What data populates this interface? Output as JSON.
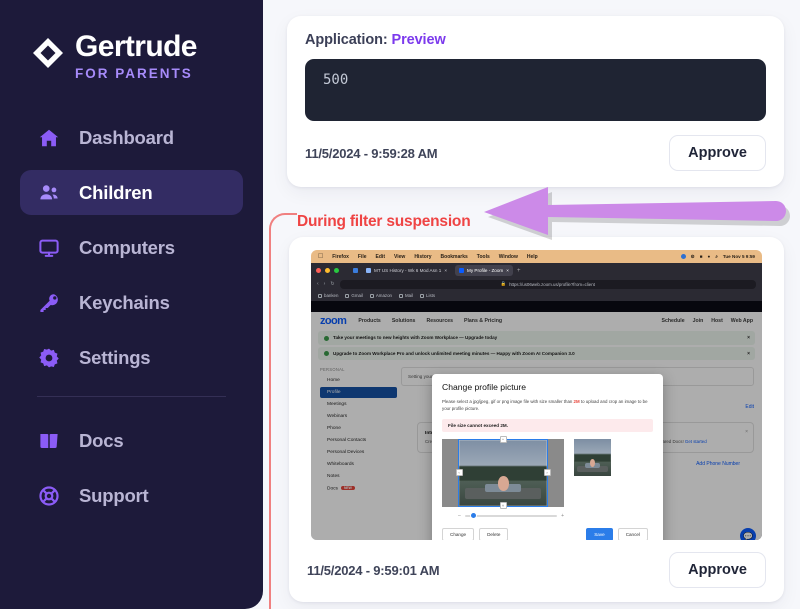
{
  "brand": {
    "name": "Gertrude",
    "subtitle": "FOR PARENTS"
  },
  "sidebar": {
    "items": [
      {
        "label": "Dashboard",
        "icon": "home-icon"
      },
      {
        "label": "Children",
        "icon": "users-icon",
        "active": true
      },
      {
        "label": "Computers",
        "icon": "monitor-icon"
      },
      {
        "label": "Keychains",
        "icon": "key-icon"
      },
      {
        "label": "Settings",
        "icon": "gear-icon"
      }
    ],
    "secondary": [
      {
        "label": "Docs",
        "icon": "book-icon"
      },
      {
        "label": "Support",
        "icon": "lifebuoy-icon"
      }
    ]
  },
  "cards": [
    {
      "app_label": "Application:",
      "app_name": "Preview",
      "code": "500",
      "timestamp": "11/5/2024 - 9:59:28 AM",
      "approve_label": "Approve"
    },
    {
      "timestamp": "11/5/2024 - 9:59:01 AM",
      "approve_label": "Approve"
    }
  ],
  "annotation": {
    "label": "During filter suspension",
    "arrow": "left-arrow-icon",
    "color": "#ef4444"
  },
  "screenshot": {
    "os_menu": [
      "Firefox",
      "File",
      "Edit",
      "View",
      "History",
      "Bookmarks",
      "Tools",
      "Window",
      "Help"
    ],
    "os_clock": "Tue Nov 5  9:59",
    "tabs": [
      {
        "title": "MT US History - Wk 6 Mod Asn 1",
        "active": false
      },
      {
        "title": "My Profile - Zoom",
        "active": true
      }
    ],
    "url": "https://us06web.zoom.us/profile?from=client",
    "bookmarks": [
      "banken",
      "Gmail",
      "Amazon",
      "Mail",
      "Lists"
    ],
    "site": {
      "logo": "zoom",
      "nav": [
        "Products",
        "Solutions",
        "Resources",
        "Plans & Pricing"
      ],
      "nav_right": [
        "Schedule",
        "Join",
        "Host",
        "Web App"
      ],
      "notices": [
        "Take your meetings to new heights with Zoom Workplace — Upgrade today",
        "Upgrade to Zoom Workplace Pro and unlock unlimited meeting minutes — Happy with Zoom AI Companion 3.0"
      ],
      "sidebar_section": "PERSONAL",
      "sidebar_items": [
        {
          "label": "Home"
        },
        {
          "label": "Profile",
          "active": true
        },
        {
          "label": "Meetings"
        },
        {
          "label": "Webinars"
        },
        {
          "label": "Phone"
        },
        {
          "label": "Personal Contacts"
        },
        {
          "label": "Personal Devices"
        },
        {
          "label": "Whiteboards"
        },
        {
          "label": "Notes"
        },
        {
          "label": "Docs",
          "badge": "NEW"
        }
      ],
      "panel_text": "Setting your name and profile picture. Only the account owner and host when you are in a meeting, webinar.",
      "panel_link": "account owner",
      "edit_link": "Edit",
      "promo": {
        "title": "Introducing Zoom Docs",
        "body": "Create, share, and co-edit on Docs directly in meetings or the Zoom app for real-time updates. Try it today with two free shared Docs!",
        "link": "Get started"
      },
      "add_phone": "Add Phone Number"
    },
    "modal": {
      "title": "Change profile picture",
      "body_before": "Please select a jpg/jpeg, gif or png image file with size smaller than ",
      "body_highlight": "2M",
      "body_after": " to upload and crop an image to be your profile picture.",
      "error": "File size cannot exceed 2M.",
      "buttons_left": [
        "Change",
        "Delete"
      ],
      "buttons_right": [
        "Save",
        "Cancel"
      ],
      "zoom_out": "–",
      "zoom_in": "+"
    }
  }
}
